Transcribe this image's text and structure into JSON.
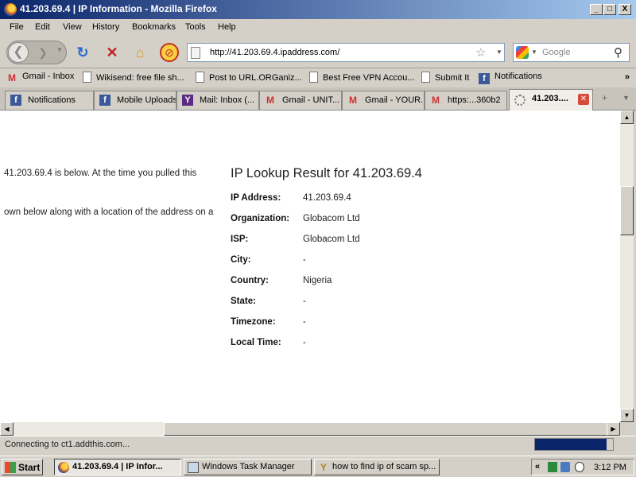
{
  "window": {
    "title": "41.203.69.4 | IP Information - Mozilla Firefox",
    "buttons": {
      "minimize": "_",
      "maximize": "□",
      "close": "X"
    }
  },
  "menu": [
    "File",
    "Edit",
    "View",
    "History",
    "Bookmarks",
    "Tools",
    "Help"
  ],
  "navbar": {
    "url": "http://41.203.69.4.ipaddress.com/",
    "search_placeholder": "Google",
    "icons": [
      "back-icon",
      "forward-icon",
      "reload-icon",
      "stop-icon",
      "home-icon",
      "addon-icon"
    ]
  },
  "bookmarks": {
    "items": [
      {
        "label": "Gmail - Inbox",
        "icon": "gmail"
      },
      {
        "label": "Wikisend: free file sh...",
        "icon": "page"
      },
      {
        "label": "Post to URL.ORGaniz...",
        "icon": "page"
      },
      {
        "label": "Best Free VPN Accou...",
        "icon": "page"
      },
      {
        "label": "Submit It",
        "icon": "page"
      },
      {
        "label": "Notifications",
        "icon": "facebook"
      }
    ],
    "more": "»"
  },
  "tabs": [
    {
      "label": "Notifications",
      "icon": "facebook"
    },
    {
      "label": "Mobile Uploads",
      "icon": "facebook"
    },
    {
      "label": "Mail: Inbox (...",
      "icon": "yahoo"
    },
    {
      "label": "Gmail - UNIT...",
      "icon": "gmail"
    },
    {
      "label": "Gmail - YOUR...",
      "icon": "gmail"
    },
    {
      "label": "https:...360b2",
      "icon": "gmail"
    },
    {
      "label": "41.203....",
      "icon": "loading",
      "active": true
    }
  ],
  "content": {
    "left_text_1": "41.203.69.4 is below. At the time you pulled this",
    "left_text_2": "own below along with a location of the address on a",
    "heading": "IP Lookup Result for 41.203.69.4",
    "rows": [
      {
        "label": "IP Address:",
        "value": "41.203.69.4"
      },
      {
        "label": "Organization:",
        "value": "Globacom Ltd"
      },
      {
        "label": "ISP:",
        "value": "Globacom Ltd"
      },
      {
        "label": "City:",
        "value": "-"
      },
      {
        "label": "Country:",
        "value": "Nigeria"
      },
      {
        "label": "State:",
        "value": "-"
      },
      {
        "label": "Timezone:",
        "value": "-"
      },
      {
        "label": "Local Time:",
        "value": "-"
      }
    ]
  },
  "status": {
    "text": "Connecting to ct1.addthis.com...",
    "progress": 0.92
  },
  "taskbar": {
    "start": "Start",
    "tasks": [
      {
        "label": "41.203.69.4 | IP Infor...",
        "active": true
      },
      {
        "label": "Windows Task Manager",
        "active": false
      },
      {
        "label": "how to find ip of scam sp...",
        "active": false
      }
    ],
    "tray_chevron": "«",
    "clock": "3:12 PM"
  },
  "colors": {
    "titlebar": "#0a246a",
    "progress": "#0a246a",
    "close_tab": "#d84a3a"
  }
}
